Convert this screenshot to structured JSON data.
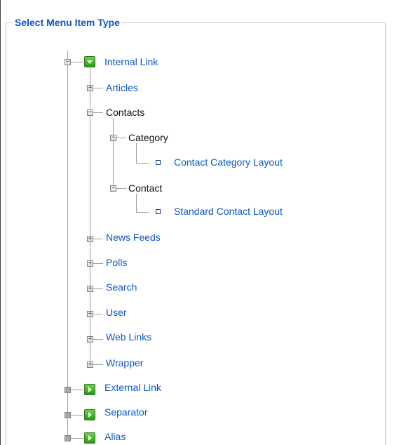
{
  "legend": "Select Menu Item Type",
  "tree": {
    "internal_link": "Internal Link",
    "articles": "Articles",
    "contacts": "Contacts",
    "category": "Category",
    "contact_category_layout": "Contact Category Layout",
    "contact": "Contact",
    "standard_contact_layout": "Standard Contact Layout",
    "news_feeds": "News Feeds",
    "polls": "Polls",
    "search": "Search",
    "user": "User",
    "web_links": "Web Links",
    "wrapper": "Wrapper",
    "external_link": "External Link",
    "separator": "Separator",
    "alias": "Alias"
  },
  "colors": {
    "link": "#0b55c4",
    "text": "#111111",
    "green_icon": "#2a9a16",
    "border": "#c8c8c8"
  }
}
